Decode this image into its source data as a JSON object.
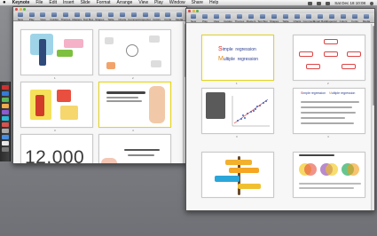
{
  "menubar": {
    "apple": "",
    "app_name": "Keynote",
    "items": [
      "File",
      "Edit",
      "Insert",
      "Slide",
      "Format",
      "Arrange",
      "View",
      "Play",
      "Window",
      "Share",
      "Help"
    ],
    "clock": "Sat Dec 18  10:08"
  },
  "toolbar": {
    "items": [
      "New",
      "Play",
      "View",
      "Guides",
      "Themes",
      "Masters",
      "Text Box",
      "Shapes",
      "Table",
      "Charts",
      "Comment",
      "Smart Build",
      "Inspector",
      "Colors",
      "Fonts",
      "Media"
    ]
  },
  "left_window": {
    "slides": [
      {
        "num": "1"
      },
      {
        "num": "2"
      },
      {
        "num": "3"
      },
      {
        "num": "4"
      },
      {
        "num": "5"
      },
      {
        "num": "6"
      }
    ],
    "big_number": "12,000"
  },
  "right_window": {
    "slide1": {
      "word1_cap": "S",
      "word1": "imple",
      "word1b": "regression",
      "word2_cap": "M",
      "word2": "ultiple",
      "word2b": "regression"
    },
    "slides": [
      {
        "num": "1"
      },
      {
        "num": "2"
      },
      {
        "num": "3"
      },
      {
        "num": "4"
      },
      {
        "num": "5"
      },
      {
        "num": "6"
      },
      {
        "num": "7"
      },
      {
        "num": "8"
      }
    ],
    "slide4": {
      "title_a": "S",
      "title_a2": "imple regression",
      "title_b": "M",
      "title_b2": "ultiple regression"
    }
  },
  "colors": {
    "selection": "#e4d51c",
    "title_blue": "#2a3c8e",
    "accent_red": "#e02323",
    "accent_orange": "#e08a12"
  }
}
